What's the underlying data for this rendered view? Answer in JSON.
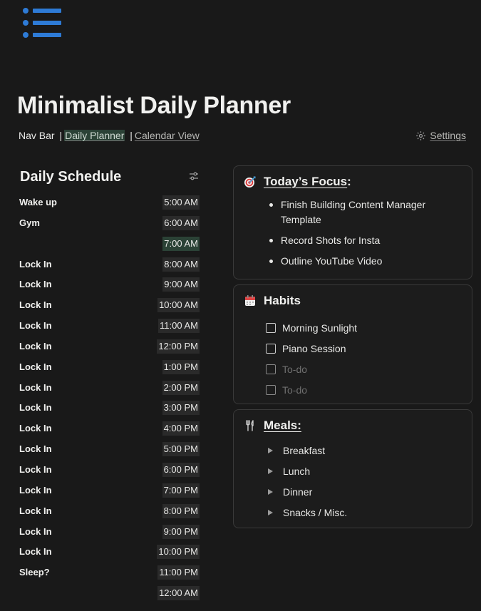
{
  "page": {
    "title": "Minimalist Daily Planner",
    "icon": "list-icon",
    "accent_color": "#2e7bd6"
  },
  "nav": {
    "prefix": "Nav Bar",
    "separator": "|",
    "links": [
      {
        "label": "Daily Planner",
        "active": true
      },
      {
        "label": "Calendar View",
        "active": false
      }
    ],
    "settings_label": "Settings",
    "settings_icon": "gear-icon"
  },
  "schedule": {
    "title": "Daily Schedule",
    "filter_icon": "sliders-icon",
    "rows": [
      {
        "activity": "Wake up",
        "time": "5:00 AM"
      },
      {
        "activity": "Gym",
        "time": "6:00 AM"
      },
      {
        "activity": "",
        "time": "7:00 AM",
        "highlight": true
      },
      {
        "activity": "Lock In",
        "time": "8:00 AM"
      },
      {
        "activity": "Lock In",
        "time": "9:00 AM"
      },
      {
        "activity": "Lock In",
        "time": "10:00 AM"
      },
      {
        "activity": "Lock In",
        "time": "11:00 AM"
      },
      {
        "activity": "Lock In",
        "time": "12:00 PM"
      },
      {
        "activity": "Lock In",
        "time": "1:00 PM"
      },
      {
        "activity": "Lock In",
        "time": "2:00 PM"
      },
      {
        "activity": "Lock In",
        "time": "3:00 PM"
      },
      {
        "activity": "Lock In",
        "time": "4:00 PM"
      },
      {
        "activity": "Lock In",
        "time": "5:00 PM"
      },
      {
        "activity": "Lock In",
        "time": "6:00 PM"
      },
      {
        "activity": "Lock In",
        "time": "7:00 PM"
      },
      {
        "activity": "Lock In",
        "time": "8:00 PM"
      },
      {
        "activity": "Lock In",
        "time": "9:00 PM"
      },
      {
        "activity": "Lock In",
        "time": "10:00 PM"
      },
      {
        "activity": "Sleep?",
        "time": "11:00 PM"
      },
      {
        "activity": "",
        "time": "12:00 AM"
      }
    ]
  },
  "focus": {
    "title": "Today’s Focus",
    "suffix": ":",
    "icon": "target-icon",
    "items": [
      "Finish Building Content Manager Template",
      "Record Shots for Insta",
      "Outline YouTube Video"
    ]
  },
  "habits": {
    "title": "Habits",
    "icon": "calendar-icon",
    "items": [
      {
        "label": "Morning Sunlight",
        "placeholder": false
      },
      {
        "label": "Piano Session",
        "placeholder": false
      },
      {
        "label": "To-do",
        "placeholder": true
      },
      {
        "label": "To-do",
        "placeholder": true
      }
    ]
  },
  "meals": {
    "title": "Meals:",
    "icon": "fork-knife-icon",
    "items": [
      "Breakfast",
      "Lunch",
      "Dinner",
      "Snacks / Misc."
    ]
  }
}
